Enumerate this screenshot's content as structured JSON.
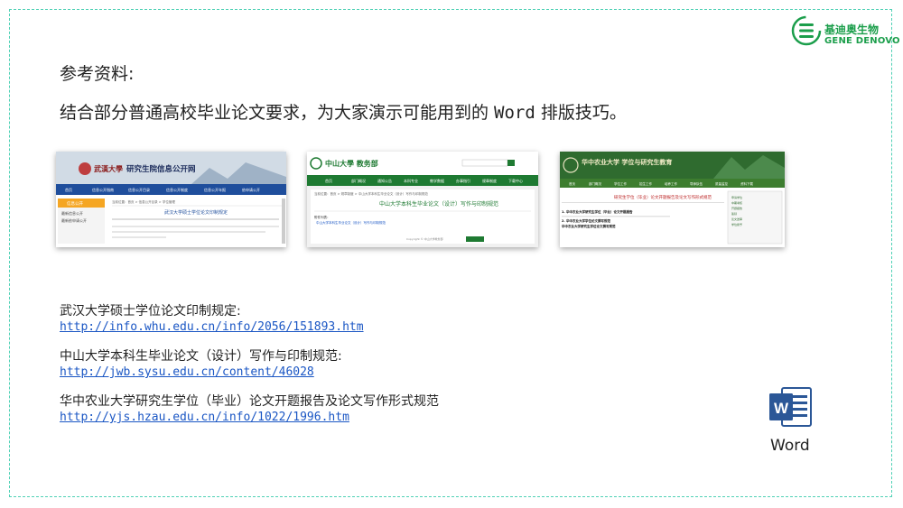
{
  "logo": {
    "cn": "基迪奥生物",
    "en": "GENE DENOVO",
    "brand_color": "#1b9e4b"
  },
  "heading": "参考资料:",
  "intro": {
    "before": "结合部分普通高校毕业论文要求，为大家演示可能用到的 ",
    "word": "Word",
    "after": " 排版技巧。"
  },
  "thumbnails": [
    {
      "site": "研究生院信息公开网",
      "title": "武汉大学硕士学位论文印制规定",
      "header_color": "#1f4e9c"
    },
    {
      "site": "中山大學 教务部",
      "title": "中山大学本科生毕业论文（设计）写作与印制规范",
      "header_color": "#1e7a32",
      "menu": [
        "首页",
        "部门概况",
        "通知公告",
        "本科专业",
        "教学数据",
        "办事指引",
        "规章制度",
        "下载中心"
      ]
    },
    {
      "site": "华中农业大学 学位与研究生教育",
      "title": "研究生学位（毕业）论文开题报告及论文写作形式规范",
      "header_color": "#2f6b2f"
    }
  ],
  "references": [
    {
      "title": "武汉大学硕士学位论文印制规定:",
      "url": "http://info.whu.edu.cn/info/2056/151893.htm"
    },
    {
      "title": "中山大学本科生毕业论文（设计）写作与印制规范:",
      "url": "http://jwb.sysu.edu.cn/content/46028"
    },
    {
      "title": "华中农业大学研究生学位（毕业）论文开题报告及论文写作形式规范",
      "url": "http://yjs.hzau.edu.cn/info/1022/1996.htm"
    }
  ],
  "word_icon": {
    "letter": "W",
    "label": "Word",
    "color": "#2b5797"
  },
  "frame_color": "#4fd1b5"
}
